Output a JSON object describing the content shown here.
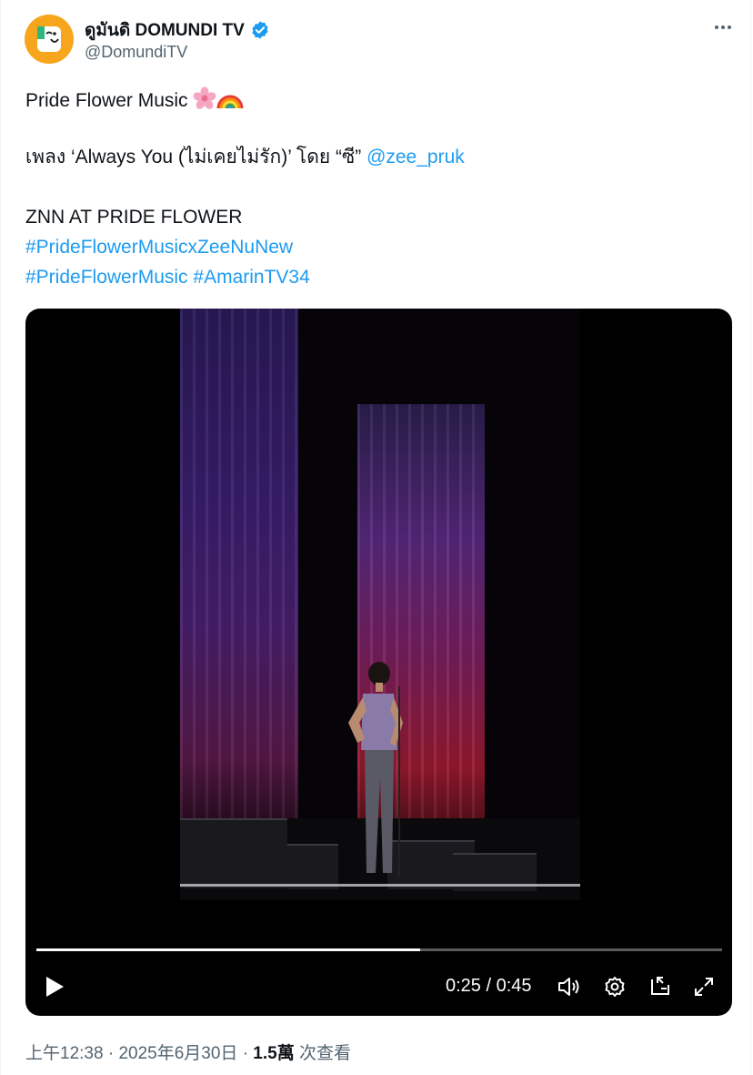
{
  "author": {
    "display_name": "ดูมันดิ DOMUNDI TV",
    "handle": "@DomundiTV",
    "verified": true,
    "avatar_color": "#f7a51c"
  },
  "tweet": {
    "line1": "Pride Flower Music",
    "line1_emojis": [
      "cherry-blossom-icon",
      "rainbow-icon"
    ],
    "line2_prefix": "เพลง ‘Always You (ไม่เคยไม่รัก)’ โดย “ซี” ",
    "line2_mention": "@zee_pruk",
    "line3": "ZNN AT PRIDE FLOWER",
    "hashtag1": "#PrideFlowerMusicxZeeNuNew",
    "hashtag2": "#PrideFlowerMusic",
    "hashtag3": "#AmarinTV34"
  },
  "video": {
    "current_time": "0:25",
    "duration": "0:45",
    "timecode": "0:25 / 0:45",
    "progress": 0.56
  },
  "meta": {
    "time": "上午12:38",
    "date": "2025年6月30日",
    "views_count": "1.5萬",
    "views_label": "次查看",
    "separator": "·"
  },
  "colors": {
    "link": "#1d9bf0",
    "secondary_text": "#536471",
    "verified": "#1d9bf0"
  }
}
